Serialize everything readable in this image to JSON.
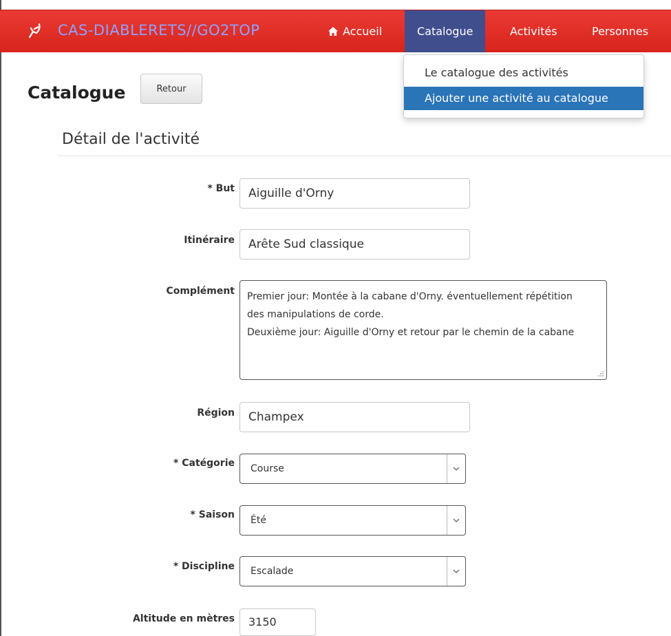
{
  "navbar": {
    "brand": "CAS-DIABLERETS//GO2TOP",
    "items": [
      {
        "label": "Accueil",
        "icon": "home-icon"
      },
      {
        "label": "Catalogue",
        "active": true
      },
      {
        "label": "Activités"
      },
      {
        "label": "Personnes"
      }
    ],
    "colors": {
      "bar": "#e0302a",
      "active": "#404e8d",
      "brand_text": "#8da2ff"
    }
  },
  "dropdown": {
    "items": [
      {
        "label": "Le catalogue des activités"
      },
      {
        "label": "Ajouter une activité au catalogue",
        "highlighted": true
      }
    ]
  },
  "page": {
    "title": "Catalogue",
    "back_button": "Retour",
    "section_title": "Détail de l'activité"
  },
  "form": {
    "but": {
      "label": "* But",
      "value": "Aiguille d'Orny"
    },
    "itineraire": {
      "label": "Itinéraire",
      "value": "Arête Sud classique"
    },
    "complement": {
      "label": "Complément",
      "lines": [
        "Premier jour: Montée à la cabane d'Orny. éventuellement répétition",
        "des manipulations de corde.",
        "Deuxième jour: Aiguille d'Orny et retour par le chemin de la cabane"
      ]
    },
    "region": {
      "label": "Région",
      "value": "Champex"
    },
    "categorie": {
      "label": "* Catégorie",
      "value": "Course"
    },
    "saison": {
      "label": "* Saison",
      "value": "Été"
    },
    "discipline": {
      "label": "* Discipline",
      "value": "Escalade"
    },
    "altitude": {
      "label": "Altitude en mètres",
      "value": "3150"
    }
  }
}
